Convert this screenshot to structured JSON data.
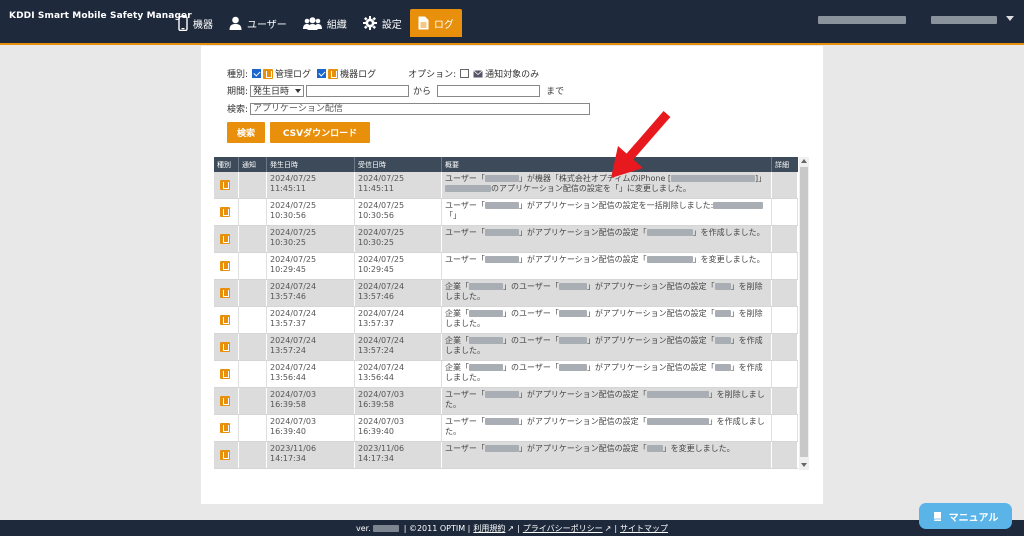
{
  "header": {
    "brand": "KDDI Smart Mobile Safety Manager",
    "nav": [
      {
        "label": "機器",
        "icon": "phone-icon"
      },
      {
        "label": "ユーザー",
        "icon": "user-icon"
      },
      {
        "label": "組織",
        "icon": "group-icon"
      },
      {
        "label": "設定",
        "icon": "gear-icon"
      },
      {
        "label": "ログ",
        "icon": "document-icon",
        "active": true
      }
    ]
  },
  "filters": {
    "type_label": "種別:",
    "admin_log": "管理ログ",
    "device_log": "機器ログ",
    "option_label": "オプション:",
    "notify_only": "通知対象のみ",
    "period_label": "期間:",
    "period_select": "発生日時",
    "from_label": "から",
    "to_label": "まで",
    "search_label": "検索:",
    "search_value": "アプリケーション配信"
  },
  "buttons": {
    "search": "検索",
    "csv": "CSVダウンロード"
  },
  "table": {
    "headers": [
      "種別",
      "通知",
      "発生日時",
      "受信日時",
      "概要",
      "詳細"
    ],
    "rows": [
      {
        "occurred_date": "2024/07/25",
        "occurred_time": "11:45:11",
        "received_date": "2024/07/25",
        "received_time": "11:45:11",
        "summary": [
          "ユーザー「",
          "」が機器「株式会社オプティムのiPhone [",
          "]」",
          "のアプリケーション配信の設定を「",
          "」に変更しました。"
        ]
      },
      {
        "occurred_date": "2024/07/25",
        "occurred_time": "10:30:56",
        "received_date": "2024/07/25",
        "received_time": "10:30:56",
        "summary": [
          "ユーザー「",
          "」がアプリケーション配信の設定を一括削除しました:",
          "「",
          "」"
        ]
      },
      {
        "occurred_date": "2024/07/25",
        "occurred_time": "10:30:25",
        "received_date": "2024/07/25",
        "received_time": "10:30:25",
        "summary": [
          "ユーザー「",
          "」がアプリケーション配信の設定「",
          "」を作成しました。"
        ]
      },
      {
        "occurred_date": "2024/07/25",
        "occurred_time": "10:29:45",
        "received_date": "2024/07/25",
        "received_time": "10:29:45",
        "summary": [
          "ユーザー「",
          "」がアプリケーション配信の設定「",
          "」を変更しました。"
        ]
      },
      {
        "occurred_date": "2024/07/24",
        "occurred_time": "13:57:46",
        "received_date": "2024/07/24",
        "received_time": "13:57:46",
        "summary": [
          "企業「",
          "」のユーザー「",
          "」がアプリケーション配信の設定「",
          "」を削除",
          "しました。"
        ]
      },
      {
        "occurred_date": "2024/07/24",
        "occurred_time": "13:57:37",
        "received_date": "2024/07/24",
        "received_time": "13:57:37",
        "summary": [
          "企業「",
          "」のユーザー「",
          "」がアプリケーション配信の設定「",
          "」を削除",
          "しました。"
        ]
      },
      {
        "occurred_date": "2024/07/24",
        "occurred_time": "13:57:24",
        "received_date": "2024/07/24",
        "received_time": "13:57:24",
        "summary": [
          "企業「",
          "」のユーザー「",
          "」がアプリケーション配信の設定「",
          "」を作成",
          "しました。"
        ]
      },
      {
        "occurred_date": "2024/07/24",
        "occurred_time": "13:56:44",
        "received_date": "2024/07/24",
        "received_time": "13:56:44",
        "summary": [
          "企業「",
          "」のユーザー「",
          "」がアプリケーション配信の設定「",
          "」を作成",
          "しました。"
        ]
      },
      {
        "occurred_date": "2024/07/03",
        "occurred_time": "16:39:58",
        "received_date": "2024/07/03",
        "received_time": "16:39:58",
        "summary": [
          "ユーザー「",
          "」がアプリケーション配信の設定「",
          "」を削除しま",
          "した。"
        ]
      },
      {
        "occurred_date": "2024/07/03",
        "occurred_time": "16:39:40",
        "received_date": "2024/07/03",
        "received_time": "16:39:40",
        "summary": [
          "ユーザー「",
          "」がアプリケーション配信の設定「",
          "」を作成しま",
          "した。"
        ]
      },
      {
        "occurred_date": "2023/11/06",
        "occurred_time": "14:17:34",
        "received_date": "2023/11/06",
        "received_time": "14:17:34",
        "summary": [
          "ユーザー「",
          "」がアプリケーション配信の設定「",
          "」を変更しました。"
        ]
      }
    ]
  },
  "footer": {
    "version_prefix": "ver.",
    "copyright": "| ©2011 OPTIM |",
    "terms": "利用規約",
    "privacy": "プライバシーポリシー",
    "sitemap": "サイトマップ",
    "sep": "|"
  },
  "manual_button": "マニュアル",
  "colors": {
    "header": "#1e2a3c",
    "accent": "#e8900c",
    "manual": "#5bb4e8",
    "annotation": "#e8191e"
  }
}
